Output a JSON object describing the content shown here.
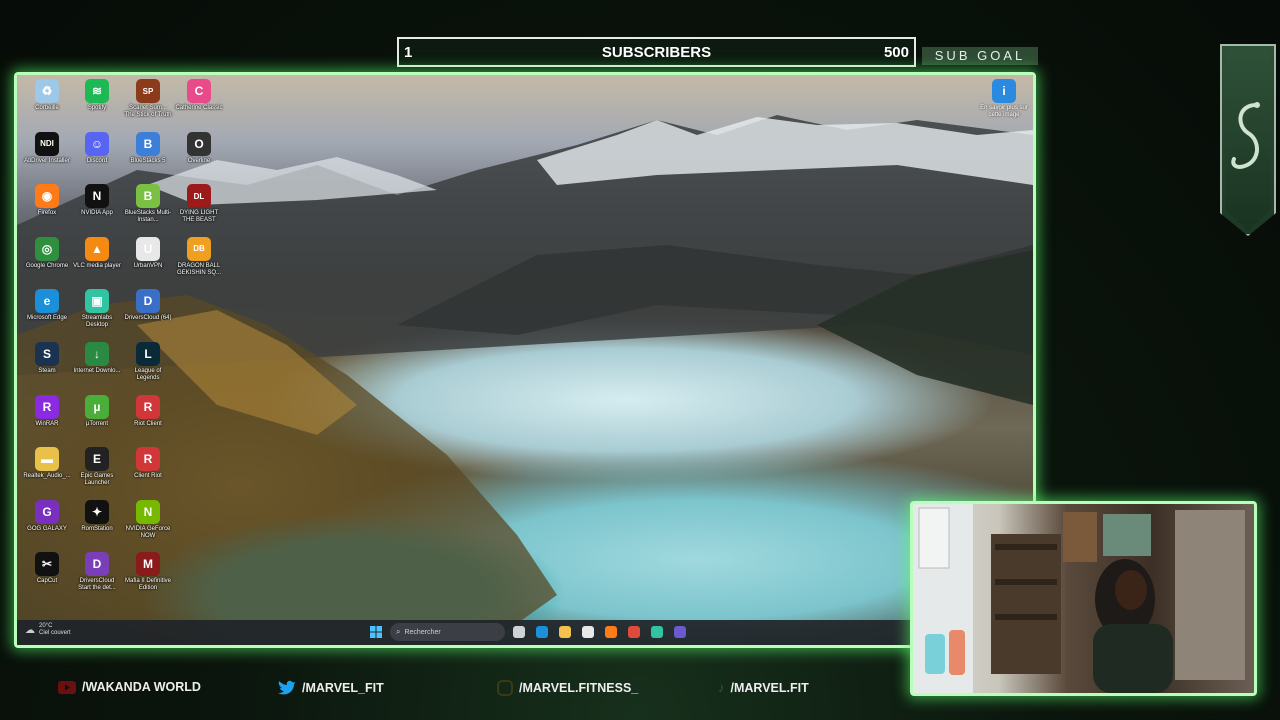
{
  "sub_goal": {
    "current": "1",
    "label": "SUBSCRIBERS",
    "target": "500",
    "tag": "SUB GOAL",
    "progress_fraction": 0.002
  },
  "desktop": {
    "icons": [
      {
        "label": "Corbeille",
        "icon": "recycle-bin-icon",
        "color": "#9ec8e8"
      },
      {
        "label": "AtiDriver Installer",
        "icon": "ndi-icon",
        "color": "#111111"
      },
      {
        "label": "Firefox",
        "icon": "firefox-icon",
        "color": "#ff7b18"
      },
      {
        "label": "Google Chrome",
        "icon": "chrome-icon",
        "color": "#2f8f3e"
      },
      {
        "label": "Microsoft Edge",
        "icon": "edge-icon",
        "color": "#1b8fd8"
      },
      {
        "label": "Steam",
        "icon": "steam-icon",
        "color": "#1b3350"
      },
      {
        "label": "WinRAR",
        "icon": "winrar-icon",
        "color": "#8a2be2"
      },
      {
        "label": "Realtek_Audio_...",
        "icon": "folder-icon",
        "color": "#e8c14a"
      },
      {
        "label": "GOG GALAXY",
        "icon": "gog-icon",
        "color": "#7b2fbe"
      },
      {
        "label": "CapCut",
        "icon": "capcut-icon",
        "color": "#111111"
      },
      {
        "label": "Spotify",
        "icon": "spotify-icon",
        "color": "#1db954"
      },
      {
        "label": "Discord",
        "icon": "discord-icon",
        "color": "#5865f2"
      },
      {
        "label": "NVIDIA App",
        "icon": "nvidia-icon",
        "color": "#111111"
      },
      {
        "label": "VLC media player",
        "icon": "vlc-icon",
        "color": "#f58a12"
      },
      {
        "label": "Streamlabs Desktop",
        "icon": "streamlabs-icon",
        "color": "#31c3a2"
      },
      {
        "label": "Internet Downlo...",
        "icon": "idm-icon",
        "color": "#2a8a44"
      },
      {
        "label": "µTorrent",
        "icon": "utorrent-icon",
        "color": "#4bad3a"
      },
      {
        "label": "Epic Games Launcher",
        "icon": "epic-icon",
        "color": "#222222"
      },
      {
        "label": "RomStation",
        "icon": "romstation-icon",
        "color": "#111111"
      },
      {
        "label": "DriversCloud Start the det...",
        "icon": "driverscloud-icon",
        "color": "#7a3fb8"
      },
      {
        "label": "Scarlet Sum... The Stick of Truth",
        "icon": "south-park-icon",
        "color": "#8b3a1a"
      },
      {
        "label": "BlueStacks 5",
        "icon": "bluestacks-icon",
        "color": "#3b7fd8"
      },
      {
        "label": "BlueStacks Multi-Instan...",
        "icon": "bluestacks-multi-icon",
        "color": "#7ac043"
      },
      {
        "label": "UrbanVPN",
        "icon": "urbanvpn-icon",
        "color": "#e8e8e8"
      },
      {
        "label": "DriversCloud (64)",
        "icon": "driverscloud64-icon",
        "color": "#3a6fc8"
      },
      {
        "label": "League of Legends",
        "icon": "lol-icon",
        "color": "#0a2a3a"
      },
      {
        "label": "Riot Client",
        "icon": "riot-icon",
        "color": "#d13639"
      },
      {
        "label": "Client Riot",
        "icon": "riot-icon-2",
        "color": "#d13639"
      },
      {
        "label": "NVIDIA GeForce NOW",
        "icon": "geforce-now-icon",
        "color": "#76b900"
      },
      {
        "label": "Mafia II Definitive Edition",
        "icon": "mafia-icon",
        "color": "#8a1b1b"
      },
      {
        "label": "Catherine Classic",
        "icon": "catherine-icon",
        "color": "#e84a8a"
      },
      {
        "label": "Overline",
        "icon": "overline-icon",
        "color": "#333333"
      },
      {
        "label": "DYING LIGHT THE BEAST",
        "icon": "dying-light-icon",
        "color": "#9b1a1a"
      },
      {
        "label": "DRAGON BALL GEKISHIN SQ...",
        "icon": "dragon-ball-icon",
        "color": "#f0a020"
      }
    ],
    "top_right_icon": {
      "label": "En savoir plus sur cette image",
      "icon": "info-image-icon"
    }
  },
  "taskbar": {
    "weather_temp": "20°C",
    "weather_desc": "Ciel couvert",
    "search_placeholder": "Rechercher",
    "apps": [
      "task-view-icon",
      "edge-icon",
      "file-explorer-icon",
      "store-icon",
      "firefox-icon",
      "chrome-icon",
      "streamlabs-icon",
      "bluestacks-icon"
    ]
  },
  "socials": [
    {
      "platform": "youtube-icon",
      "handle": "/WAKANDA WORLD",
      "color": "#e02020"
    },
    {
      "platform": "twitter-icon",
      "handle": "/MARVEL_FIT",
      "color": "#1da1f2"
    },
    {
      "platform": "instagram-icon",
      "handle": "/MARVEL.FITNESS_",
      "color": "#c9a227"
    },
    {
      "platform": "tiktok-icon",
      "handle": "/MARVEL.FIT",
      "color": "#9bb09f"
    }
  ]
}
